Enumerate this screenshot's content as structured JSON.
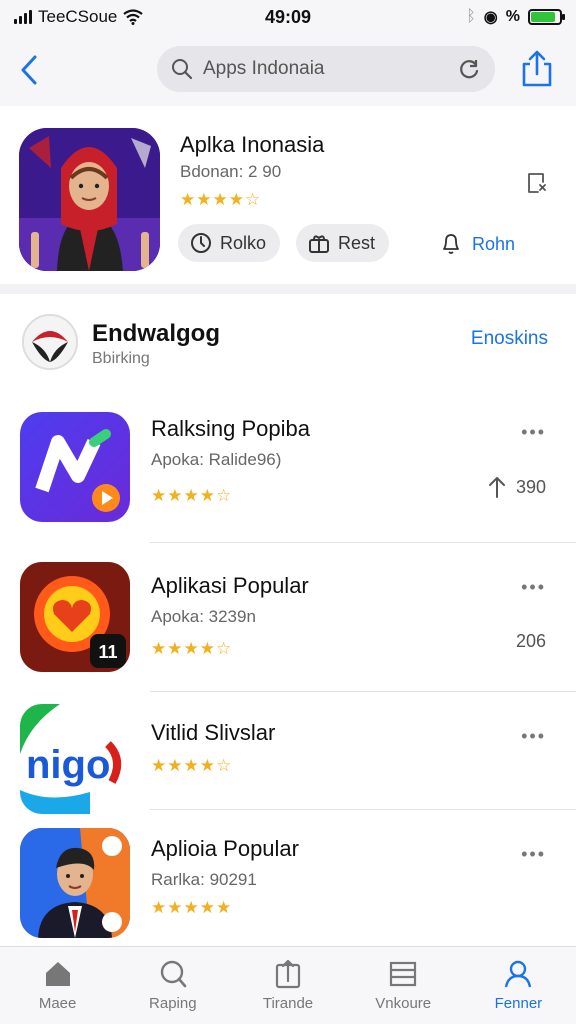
{
  "status_bar": {
    "carrier": "TeeCSoue",
    "time": "49:09",
    "battery_level": 0.85
  },
  "nav": {
    "back_icon": "chevron-left-icon",
    "search_placeholder": "Apps Indonaia",
    "search_icon": "search-icon",
    "reload_icon": "reload-icon",
    "share_icon": "share-icon"
  },
  "hero": {
    "title": "Aplka Inonasia",
    "subtitle": "Bdonan: 2 90",
    "rating": 4.5,
    "stars": "★★★★☆",
    "buttons": [
      {
        "label": "Rolko",
        "icon": "clock-icon"
      },
      {
        "label": "Rest",
        "icon": "gift-icon"
      }
    ],
    "link_label": "Rohn",
    "link_icon": "bell-icon"
  },
  "section": {
    "title": "Endwalgog",
    "subtitle": "Bbirking",
    "link": "Enoskins"
  },
  "apps": [
    {
      "title": "Ralksing Popiba",
      "subtitle": "Apoka: Ralide96)",
      "stars": "★★★★☆",
      "count": "390",
      "count_icon": "arrow-up-icon",
      "more": "•••"
    },
    {
      "title": "Aplikasi Popular",
      "subtitle": "Apoka: 3239n",
      "stars": "★★★★☆",
      "count": "206",
      "more": "•••"
    },
    {
      "title": "Vitlid Slivslar",
      "subtitle": "",
      "stars": "★★★★☆",
      "count": "",
      "more": "•••"
    },
    {
      "title": "Aplioia Popular",
      "subtitle": "Rarlka: 90291",
      "stars": "★★★★★",
      "count": "",
      "more": "•••"
    }
  ],
  "tabs": [
    {
      "label": "Maee",
      "icon": "home-icon",
      "active": false
    },
    {
      "label": "Raping",
      "icon": "search-icon",
      "active": false
    },
    {
      "label": "Tirande",
      "icon": "upload-icon",
      "active": false
    },
    {
      "label": "Vnkoure",
      "icon": "list-icon",
      "active": false
    },
    {
      "label": "Fenner",
      "icon": "person-icon",
      "active": true
    }
  ],
  "colors": {
    "accent": "#1a73e8",
    "star": "#f2b01e"
  }
}
